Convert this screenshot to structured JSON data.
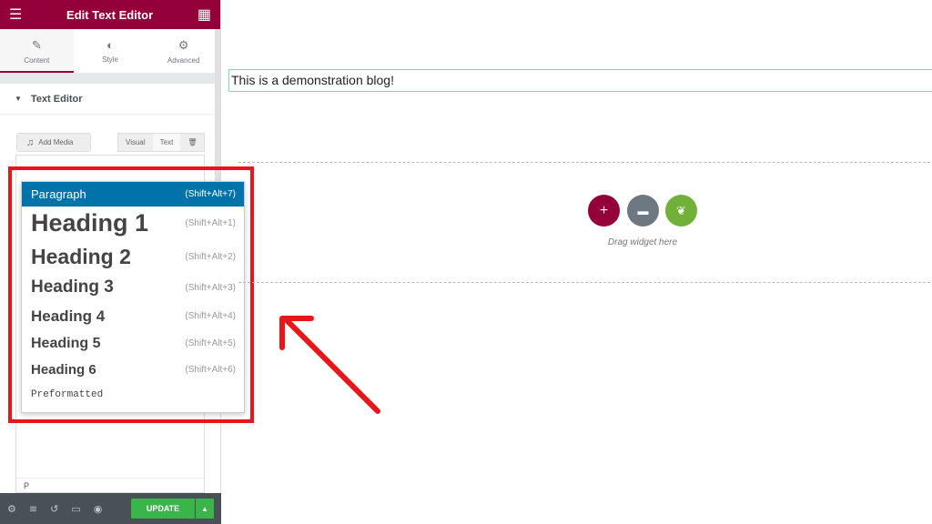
{
  "header": {
    "title": "Edit Text Editor"
  },
  "tabs": [
    {
      "label": "Content"
    },
    {
      "label": "Style"
    },
    {
      "label": "Advanced"
    }
  ],
  "section": {
    "title": "Text Editor"
  },
  "editor": {
    "add_media": "Add Media",
    "visual": "Visual",
    "text": "Text",
    "path": "P"
  },
  "dropdown": [
    {
      "label": "Paragraph",
      "shortcut": "(Shift+Alt+7)"
    },
    {
      "label": "Heading 1",
      "shortcut": "(Shift+Alt+1)"
    },
    {
      "label": "Heading 2",
      "shortcut": "(Shift+Alt+2)"
    },
    {
      "label": "Heading 3",
      "shortcut": "(Shift+Alt+3)"
    },
    {
      "label": "Heading 4",
      "shortcut": "(Shift+Alt+4)"
    },
    {
      "label": "Heading 5",
      "shortcut": "(Shift+Alt+5)"
    },
    {
      "label": "Heading 6",
      "shortcut": "(Shift+Alt+6)"
    },
    {
      "label": "Preformatted",
      "shortcut": ""
    }
  ],
  "footer": {
    "update": "UPDATE"
  },
  "canvas": {
    "blog_text": "This is a demonstration blog!",
    "drag_hint": "Drag widget here"
  },
  "colors": {
    "brand": "#93003a",
    "update": "#39b54a",
    "highlight": "#e8161b",
    "selected": "#0073aa"
  }
}
